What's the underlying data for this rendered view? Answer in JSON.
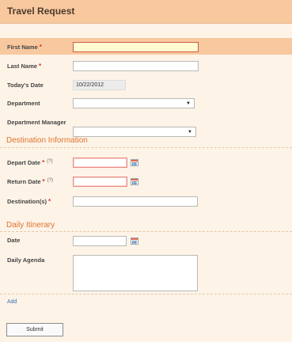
{
  "header": {
    "title": "Travel Request"
  },
  "fields": {
    "first_name": {
      "label": "First Name",
      "required_mark": "*",
      "value": ""
    },
    "last_name": {
      "label": "Last Name",
      "required_mark": "*",
      "value": ""
    },
    "todays_date": {
      "label": "Today's Date",
      "value": "10/22/2012"
    },
    "department": {
      "label": "Department",
      "value": ""
    },
    "department_manager": {
      "label": "Department Manager",
      "value": ""
    }
  },
  "destination": {
    "title": "Destination Information",
    "depart_date": {
      "label": "Depart Date",
      "required_mark": "*",
      "hint": "(?)",
      "value": ""
    },
    "return_date": {
      "label": "Return Date",
      "required_mark": "*",
      "hint": "(?)",
      "value": ""
    },
    "destinations": {
      "label": "Destination(s)",
      "required_mark": "*",
      "value": ""
    }
  },
  "itinerary": {
    "title": "Daily Itinerary",
    "date": {
      "label": "Date",
      "value": ""
    },
    "agenda": {
      "label": "Daily Agenda",
      "value": ""
    },
    "add_link": "Add"
  },
  "actions": {
    "submit_label": "Submit"
  },
  "icons": {
    "dropdown": "▼"
  },
  "colors": {
    "header_bg": "#f8c89f",
    "section_title": "#e0732d",
    "required": "#d9342b"
  }
}
